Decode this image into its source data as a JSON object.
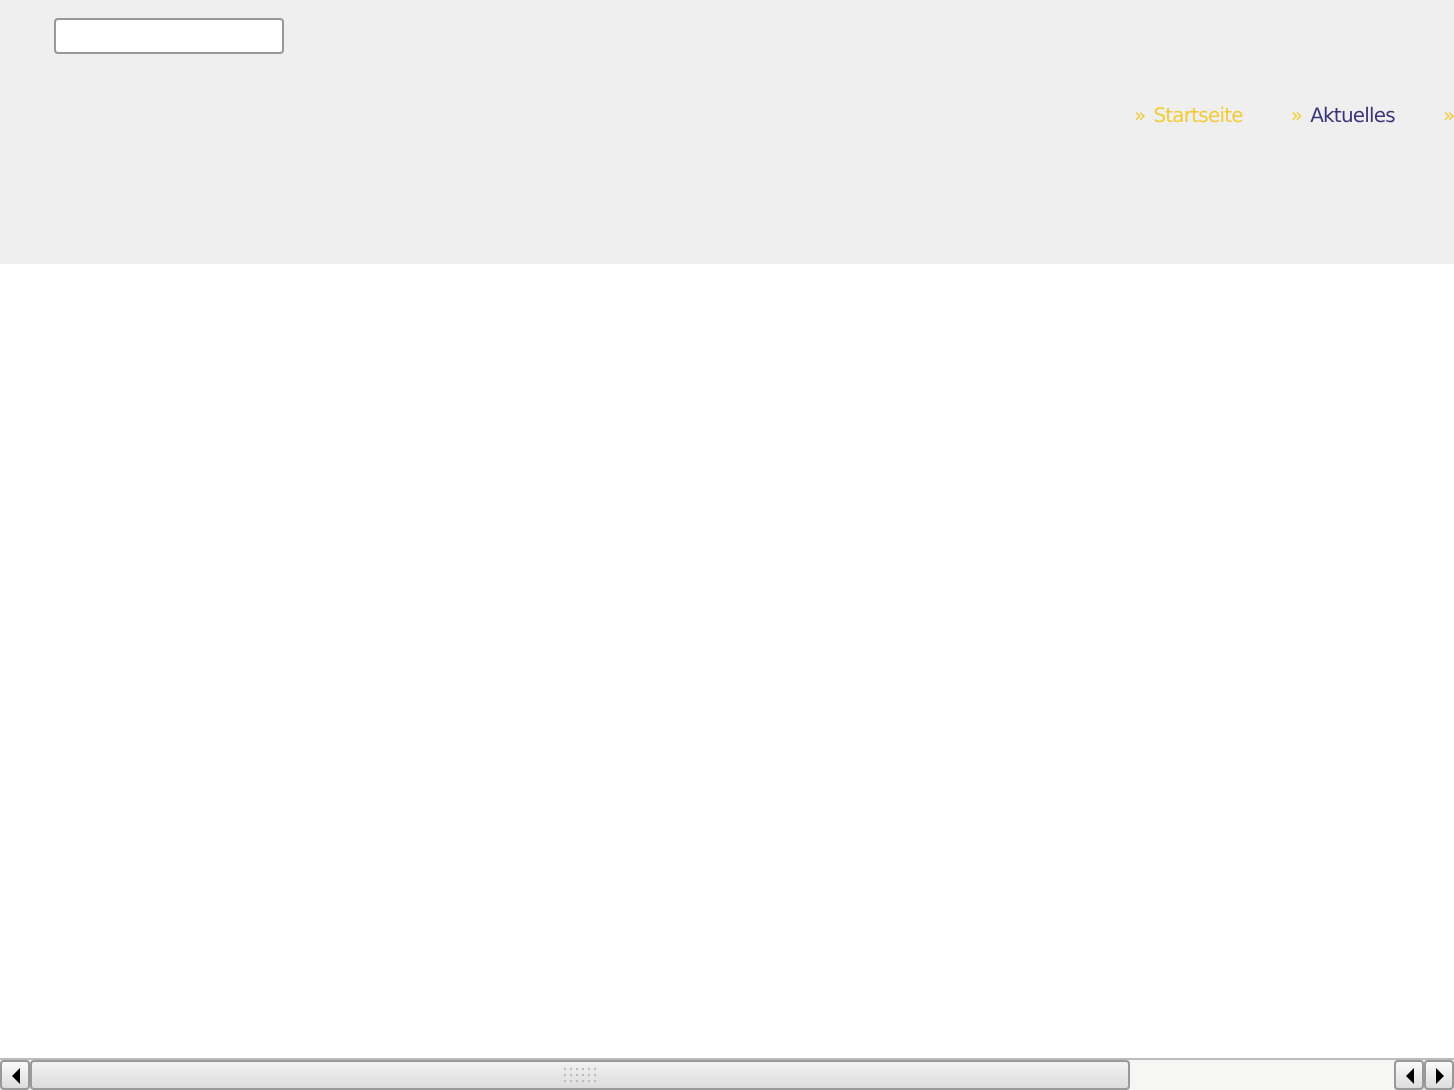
{
  "nav": [
    {
      "arrow": "»",
      "label": "Startseite",
      "selected": true
    },
    {
      "arrow": "»",
      "label": "Aktuelles",
      "selected": false
    },
    {
      "arrow": "»"
    }
  ]
}
